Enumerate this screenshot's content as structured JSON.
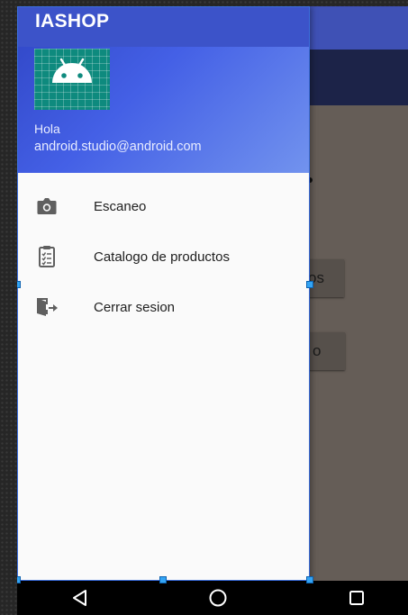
{
  "app": {
    "title": "IASHOP"
  },
  "drawer": {
    "greeting": "Hola",
    "email": "android.studio@android.com",
    "items": [
      {
        "label": "Escaneo",
        "icon": "camera-icon"
      },
      {
        "label": "Catalogo de productos",
        "icon": "clipboard-icon"
      },
      {
        "label": "Cerrar sesion",
        "icon": "exit-icon"
      }
    ]
  },
  "background": {
    "button1_partial": "os",
    "button2_partial": "o"
  },
  "colors": {
    "app_bar": "#3f51b5",
    "drawer_header_start": "#2f45c4",
    "drawer_header_end": "#7293ee",
    "content_bg": "#655d57"
  }
}
